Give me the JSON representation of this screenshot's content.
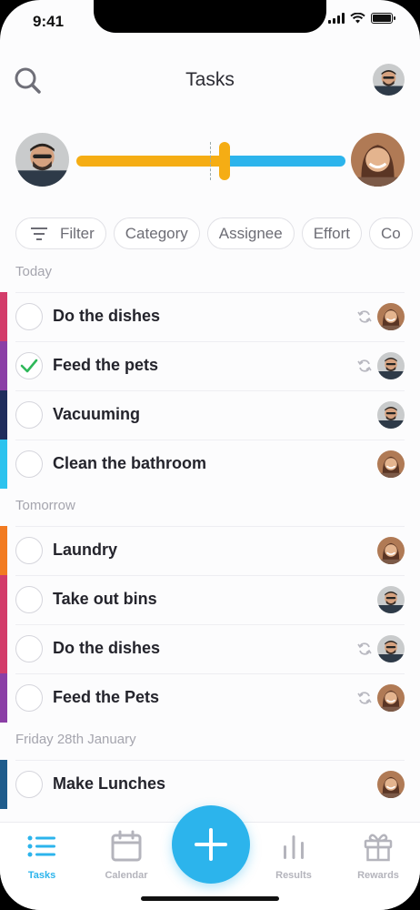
{
  "status_bar": {
    "time": "9:41"
  },
  "header": {
    "title": "Tasks"
  },
  "filters": [
    "Filter",
    "Category",
    "Assignee",
    "Effort",
    "Co"
  ],
  "balance": {
    "left_share": 0.55,
    "left_color": "#f5ad14",
    "right_color": "#2cb4ec"
  },
  "colors": {
    "accent": "#2cb4ec",
    "done": "#2fb85a"
  },
  "sections": [
    {
      "label": "Today",
      "tasks": [
        {
          "title": "Do the dishes",
          "done": false,
          "repeat": true,
          "assignee": "woman",
          "category_color": "#d33c6a"
        },
        {
          "title": "Feed the pets",
          "done": true,
          "repeat": true,
          "assignee": "man",
          "category_color": "#8b3fa6"
        },
        {
          "title": "Vacuuming",
          "done": false,
          "repeat": false,
          "assignee": "man",
          "category_color": "#1f2d5c"
        },
        {
          "title": "Clean the bathroom",
          "done": false,
          "repeat": false,
          "assignee": "woman",
          "category_color": "#2cc3ee"
        }
      ]
    },
    {
      "label": "Tomorrow",
      "tasks": [
        {
          "title": "Laundry",
          "done": false,
          "repeat": false,
          "assignee": "woman",
          "category_color": "#f27b21"
        },
        {
          "title": "Take out bins",
          "done": false,
          "repeat": false,
          "assignee": "man",
          "category_color": "#d33c6a"
        },
        {
          "title": "Do the dishes",
          "done": false,
          "repeat": true,
          "assignee": "man",
          "category_color": "#d33c6a"
        },
        {
          "title": "Feed the Pets",
          "done": false,
          "repeat": true,
          "assignee": "woman",
          "category_color": "#8b3fa6"
        }
      ]
    },
    {
      "label": "Friday 28th January",
      "tasks": [
        {
          "title": "Make Lunches",
          "done": false,
          "repeat": false,
          "assignee": "woman",
          "category_color": "#1f5c8c"
        }
      ]
    }
  ],
  "tabbar": {
    "tabs": [
      {
        "label": "Tasks",
        "icon": "list-icon",
        "active": true
      },
      {
        "label": "Calendar",
        "icon": "calendar-icon",
        "active": false
      },
      {
        "label": "Results",
        "icon": "bar-chart-icon",
        "active": false
      },
      {
        "label": "Rewards",
        "icon": "gift-icon",
        "active": false
      }
    ],
    "add_icon": "plus-icon"
  }
}
